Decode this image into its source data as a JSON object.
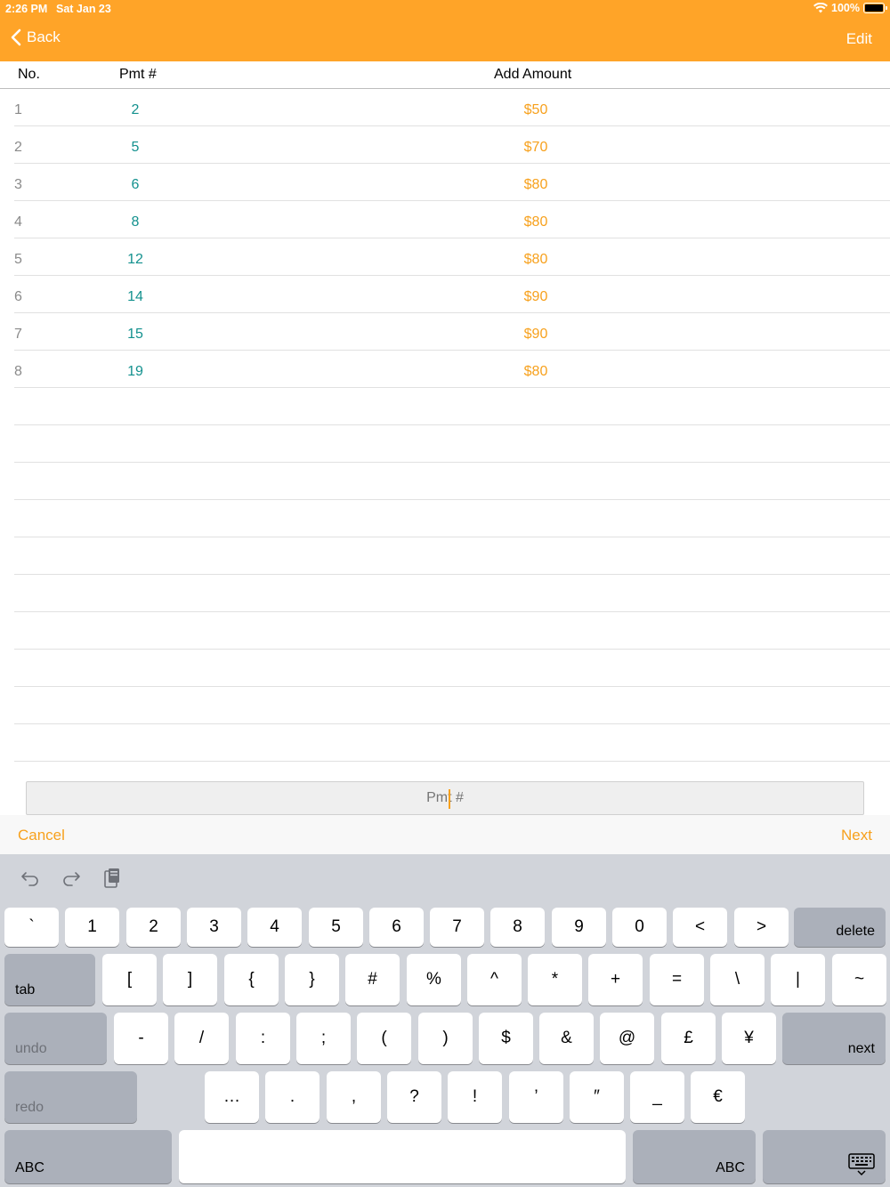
{
  "status": {
    "time": "2:26 PM",
    "date": "Sat Jan 23",
    "battery": "100%"
  },
  "nav": {
    "back_label": "Back",
    "edit_label": "Edit"
  },
  "table": {
    "headers": {
      "no": "No.",
      "pmt": "Pmt #",
      "amount": "Add Amount"
    },
    "rows": [
      {
        "no": "1",
        "pmt": "2",
        "amount": "$50"
      },
      {
        "no": "2",
        "pmt": "5",
        "amount": "$70"
      },
      {
        "no": "3",
        "pmt": "6",
        "amount": "$80"
      },
      {
        "no": "4",
        "pmt": "8",
        "amount": "$80"
      },
      {
        "no": "5",
        "pmt": "12",
        "amount": "$80"
      },
      {
        "no": "6",
        "pmt": "14",
        "amount": "$90"
      },
      {
        "no": "7",
        "pmt": "15",
        "amount": "$90"
      },
      {
        "no": "8",
        "pmt": "19",
        "amount": "$80"
      }
    ],
    "empty_rows": 10
  },
  "input": {
    "placeholder": "Pmt #",
    "value": ""
  },
  "toolbar": {
    "cancel_label": "Cancel",
    "next_label": "Next"
  },
  "keyboard": {
    "row1": [
      "`",
      "1",
      "2",
      "3",
      "4",
      "5",
      "6",
      "7",
      "8",
      "9",
      "0",
      "<",
      ">"
    ],
    "delete_label": "delete",
    "tab_label": "tab",
    "row2": [
      "[",
      "]",
      "{",
      "}",
      "#",
      "%",
      "^",
      "*",
      "+",
      "=",
      "\\",
      "|",
      "~"
    ],
    "undo_label": "undo",
    "row3": [
      "-",
      "/",
      ":",
      ";",
      "(",
      ")",
      "$",
      "&",
      "@",
      "£",
      "¥"
    ],
    "next_label": "next",
    "redo_label": "redo",
    "row4": [
      "…",
      ".",
      ",",
      "?",
      "!",
      "’",
      "″",
      "_",
      "€"
    ],
    "abc_left_label": "ABC",
    "abc_right_label": "ABC"
  },
  "colors": {
    "accent": "#FFA428",
    "pmt_text": "#13918E",
    "amount_text": "#F7A11D"
  }
}
